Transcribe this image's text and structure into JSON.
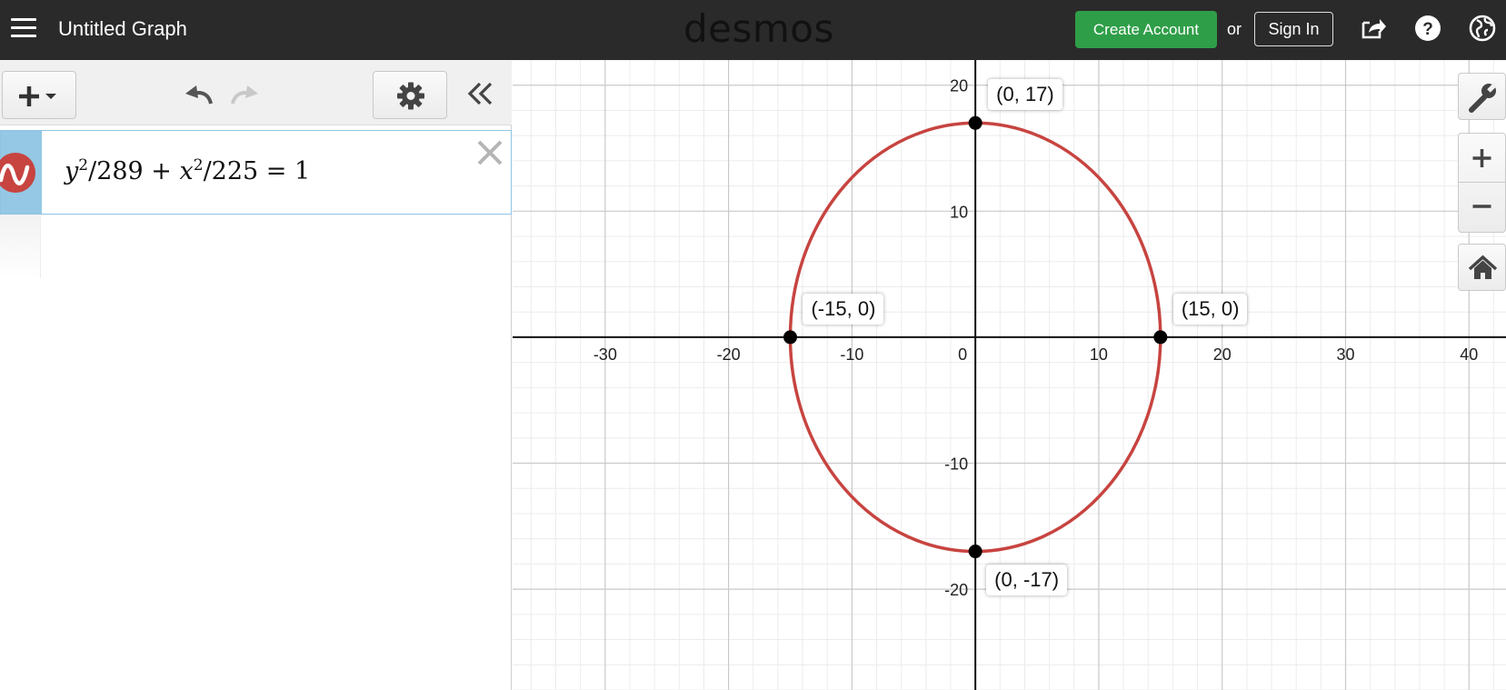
{
  "header": {
    "title": "Untitled Graph",
    "brand": "desmos",
    "create_account": "Create Account",
    "or": "or",
    "sign_in": "Sign In"
  },
  "expression_list": {
    "items": [
      {
        "latex_display": {
          "y": "y",
          "e1": "2",
          "a": "/289 + ",
          "x": "x",
          "e2": "2",
          "b": "/225 = 1"
        },
        "color": "#c74440"
      }
    ]
  },
  "colors": {
    "header_bg": "#2a2a2a",
    "accent_green": "#2f9e48",
    "curve": "#c74440",
    "expr_tab": "#94c8e4"
  },
  "icons": {
    "menu": "hamburger-icon",
    "share": "share-icon",
    "help": "help-icon",
    "language": "globe-icon",
    "add": "plus-icon",
    "undo": "undo-icon",
    "redo": "redo-icon",
    "settings": "gear-icon",
    "collapse": "double-chevron-left-icon",
    "close": "close-icon",
    "wrench": "wrench-icon",
    "zoom_in": "plus-icon",
    "zoom_out": "minus-icon",
    "home": "home-icon"
  },
  "chart_data": {
    "type": "scatter",
    "curve": {
      "kind": "ellipse",
      "a": 15,
      "b": 17
    },
    "xlim": [
      -37.5,
      43
    ],
    "ylim": [
      -28,
      22
    ],
    "x_ticks": [
      -30,
      -20,
      -10,
      0,
      10,
      20,
      30,
      40
    ],
    "y_ticks": [
      20,
      10,
      -10,
      -20
    ],
    "points": [
      {
        "x": 0,
        "y": 17,
        "label": "(0, 17)"
      },
      {
        "x": -15,
        "y": 0,
        "label": "(-15, 0)"
      },
      {
        "x": 15,
        "y": 0,
        "label": "(15, 0)"
      },
      {
        "x": 0,
        "y": -17,
        "label": "(0, -17)"
      }
    ]
  }
}
